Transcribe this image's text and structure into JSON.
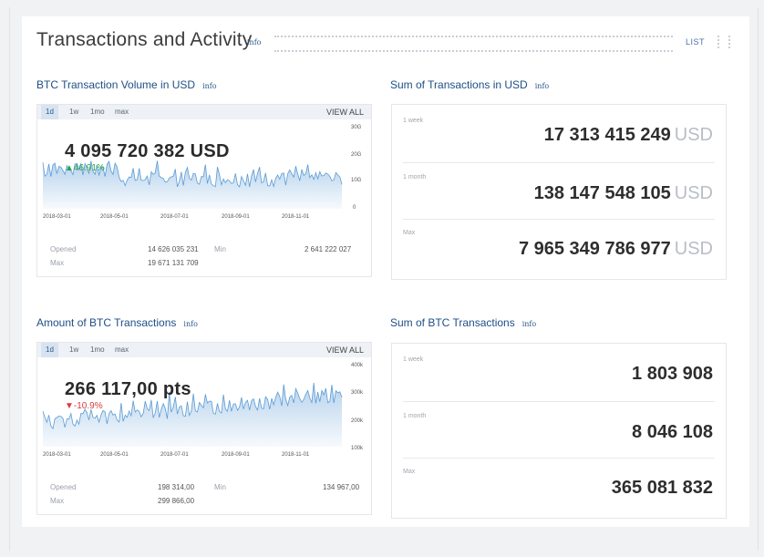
{
  "header": {
    "title": "Transactions and Activity",
    "info": "info",
    "list_label": "LIST"
  },
  "volume": {
    "title": "BTC Transaction Volume in USD",
    "info": "info",
    "tabs": [
      "1d",
      "1w",
      "1mo",
      "max"
    ],
    "view_all": "VIEW ALL",
    "value": "4 095 720 382 USD",
    "change": "▲46.91%",
    "y_ticks": [
      "30G",
      "20G",
      "10G",
      "0"
    ],
    "x_ticks": [
      "2018-03-01",
      "2018-05-01",
      "2018-07-01",
      "2018-09-01",
      "2018-11-01"
    ],
    "opened_label": "Opened",
    "opened_value": "14 626 035 231",
    "min_label": "Min",
    "min_value": "2 641 222 027",
    "max_label": "Max",
    "max_value": "19 671 131 709",
    "color": "#5b9bd5"
  },
  "amount": {
    "title": "Amount of BTC Transactions",
    "info": "info",
    "tabs": [
      "1d",
      "1w",
      "1mo",
      "max"
    ],
    "view_all": "VIEW ALL",
    "value": "266 117,00 pts",
    "change": "▼-10.9%",
    "y_ticks": [
      "400k",
      "300k",
      "200k",
      "100k"
    ],
    "x_ticks": [
      "2018-03-01",
      "2018-05-01",
      "2018-07-01",
      "2018-09-01",
      "2018-11-01"
    ],
    "opened_label": "Opened",
    "opened_value": "198 314,00",
    "min_label": "Min",
    "min_value": "134 967,00",
    "max_label": "Max",
    "max_value": "299 866,00",
    "color": "#5b9bd5"
  },
  "sum_usd": {
    "title": "Sum of Transactions in USD",
    "info": "info",
    "rows": [
      {
        "label": "1 week",
        "value": "17 313 415 249",
        "unit": "USD"
      },
      {
        "label": "1 month",
        "value": "138 147 548 105",
        "unit": "USD"
      },
      {
        "label": "Max",
        "value": "7 965 349 786 977",
        "unit": "USD"
      }
    ]
  },
  "sum_btc": {
    "title": "Sum of BTC Transactions",
    "info": "info",
    "rows": [
      {
        "label": "1 week",
        "value": "1 803 908"
      },
      {
        "label": "1 month",
        "value": "8 046 108"
      },
      {
        "label": "Max",
        "value": "365 081 832"
      }
    ]
  }
}
